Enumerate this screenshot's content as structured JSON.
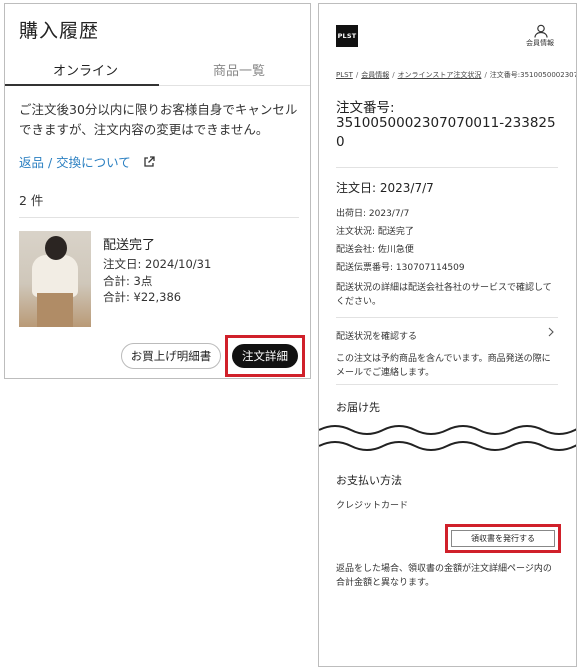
{
  "purchase_history": {
    "title": "購入履歴",
    "tabs": [
      {
        "label": "オンライン",
        "active": true
      },
      {
        "label": "商品一覧",
        "active": false
      }
    ],
    "notice": "ご注文後30分以内に限りお客様自身でキャンセルできますが、注文内容の変更はできません。",
    "returns_link": "返品 / 交換について",
    "count": "2 件",
    "order": {
      "status": "配送完了",
      "date": "注文日: 2024/10/31",
      "quantity": "合計: 3点",
      "total": "合計: ¥22,386",
      "receipt_button": "お買上げ明細書",
      "detail_button": "注文詳細"
    }
  },
  "order_detail": {
    "logo": "PLST",
    "member_label": "会員情報",
    "breadcrumb": [
      "PLST",
      "会員情報",
      "オンラインストア注文状況",
      "注文番号:35100500023070"
    ],
    "order_label": "注文番号:",
    "order_number": "3510050002307070011-2338250",
    "order_date": "注文日: 2023/7/7",
    "ship_date": "出荷日: 2023/7/7",
    "order_status": "注文状況: 配送完了",
    "carrier": "配送会社: 佐川急便",
    "tracking": "配送伝票番号: 130707114509",
    "carrier_note": "配送状況の詳細は配送会社各社のサービスで確認してください。",
    "check_shipping": "配送状況を確認する",
    "preorder_note": "この注文は予約商品を含んでいます。商品発送の際にメールでご連絡します。",
    "delivery_heading": "お届け先",
    "payment_heading": "お支払い方法",
    "payment_method": "クレジットカード",
    "receipt_issue_button": "領収書を発行する",
    "refund_note": "返品をした場合、領収書の金額が注文詳細ページ内の合計金額と異なります。"
  },
  "colors": {
    "highlight": "#d0202a",
    "link": "#2a7fc1",
    "primary_button": "#111111"
  },
  "icons": [
    "external-link-icon",
    "user-icon",
    "chevron-right-icon"
  ]
}
